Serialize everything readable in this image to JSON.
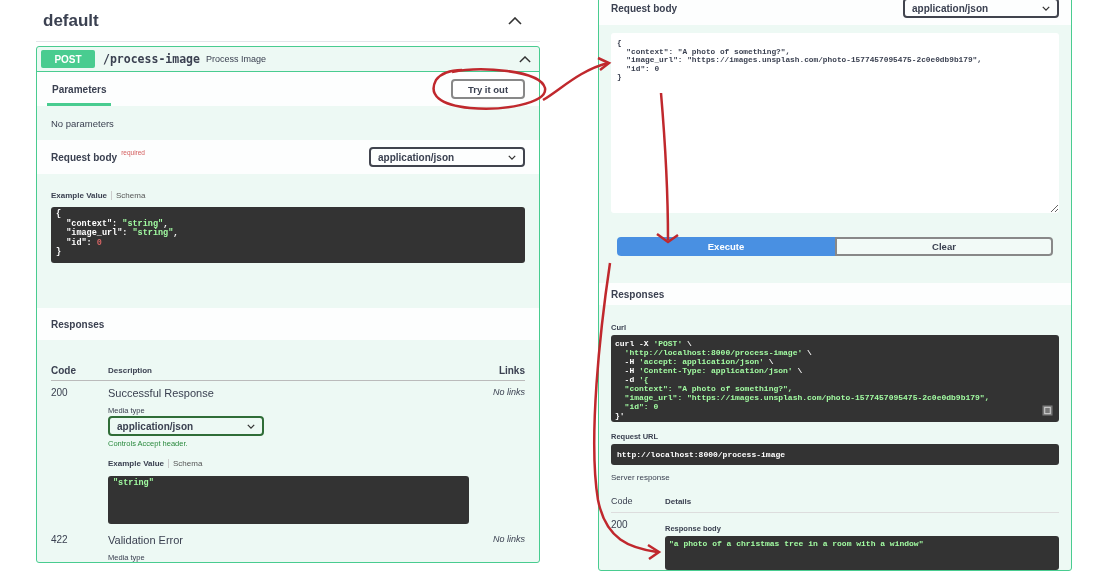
{
  "left": {
    "section_title": "default",
    "operation": {
      "method": "POST",
      "path": "/process-image",
      "summary": "Process Image"
    },
    "tabs": [
      {
        "label": "Parameters",
        "selected": true
      }
    ],
    "try_button": "Try it out",
    "no_params": "No parameters",
    "request_body": {
      "label": "Request body",
      "required": "required",
      "media_type": "application/json"
    },
    "example_tabs": [
      {
        "label": "Example Value",
        "selected": true
      },
      {
        "label": "Schema",
        "selected": false
      }
    ],
    "example_code": [
      [
        {
          "text": "{",
          "kind": "plain"
        }
      ],
      [
        {
          "text": "  \"context\": ",
          "kind": "key"
        },
        {
          "text": "\"string\"",
          "kind": "string"
        },
        {
          "text": ",",
          "kind": "plain"
        }
      ],
      [
        {
          "text": "  \"image_url\": ",
          "kind": "key"
        },
        {
          "text": "\"string\"",
          "kind": "string"
        },
        {
          "text": ",",
          "kind": "plain"
        }
      ],
      [
        {
          "text": "  \"id\": ",
          "kind": "key"
        },
        {
          "text": "0",
          "kind": "number"
        }
      ],
      [
        {
          "text": "}",
          "kind": "plain"
        }
      ]
    ],
    "responses_title": "Responses",
    "columns": [
      "Code",
      "Description",
      "Links"
    ],
    "responses": [
      {
        "code": "200",
        "description": "Successful Response",
        "links": "No links",
        "media_label": "Media type",
        "media_type": "application/json",
        "media_note": "Controls Accept header.",
        "example_tabs": [
          {
            "label": "Example Value",
            "selected": true
          },
          {
            "label": "Schema",
            "selected": false
          }
        ],
        "example_code": [
          [
            {
              "text": "\"string\"",
              "kind": "string"
            }
          ]
        ]
      },
      {
        "code": "422",
        "description": "Validation Error",
        "links": "No links",
        "media_label": "Media type"
      }
    ]
  },
  "right": {
    "request_body": {
      "label": "Request body",
      "media_type": "application/json"
    },
    "body_lines": [
      "{",
      "  \"context\": \"A photo of something?\",",
      "  \"image_url\": \"https://images.unsplash.com/photo-1577457095475-2c0e0db9b179\",",
      "  \"id\": 0",
      "}"
    ],
    "buttons": [
      {
        "label": "Execute",
        "kind": "primary"
      },
      {
        "label": "Clear",
        "kind": "secondary"
      }
    ],
    "responses_title": "Responses",
    "curl_label": "Curl",
    "curl": [
      [
        {
          "text": "curl -X ",
          "kind": "plain"
        },
        {
          "text": "'POST'",
          "kind": "string"
        },
        {
          "text": " \\",
          "kind": "plain"
        }
      ],
      [
        {
          "text": "  'http://localhost:8000/process-image'",
          "kind": "string"
        },
        {
          "text": " \\",
          "kind": "plain"
        }
      ],
      [
        {
          "text": "  -H ",
          "kind": "plain"
        },
        {
          "text": "'accept: application/json'",
          "kind": "string"
        },
        {
          "text": " \\",
          "kind": "plain"
        }
      ],
      [
        {
          "text": "  -H ",
          "kind": "plain"
        },
        {
          "text": "'Content-Type: application/json'",
          "kind": "string"
        },
        {
          "text": " \\",
          "kind": "plain"
        }
      ],
      [
        {
          "text": "  -d ",
          "kind": "plain"
        },
        {
          "text": "'{",
          "kind": "string"
        }
      ],
      [
        {
          "text": "  \"context\": \"A photo of something?\",",
          "kind": "string"
        }
      ],
      [
        {
          "text": "  \"image_url\": \"https://images.unsplash.com/photo-1577457095475-2c0e0db9b179\",",
          "kind": "string"
        }
      ],
      [
        {
          "text": "  \"id\": 0",
          "kind": "string"
        }
      ],
      [
        {
          "text": "}'",
          "kind": "plain"
        }
      ]
    ],
    "request_url_label": "Request URL",
    "request_url": "http://localhost:8000/process-image",
    "server_response_label": "Server response",
    "columns": [
      "Code",
      "Details"
    ],
    "response_code": "200",
    "response_body_label": "Response body",
    "response_body": "\"a photo of a christmas tree in a room with a window\""
  }
}
